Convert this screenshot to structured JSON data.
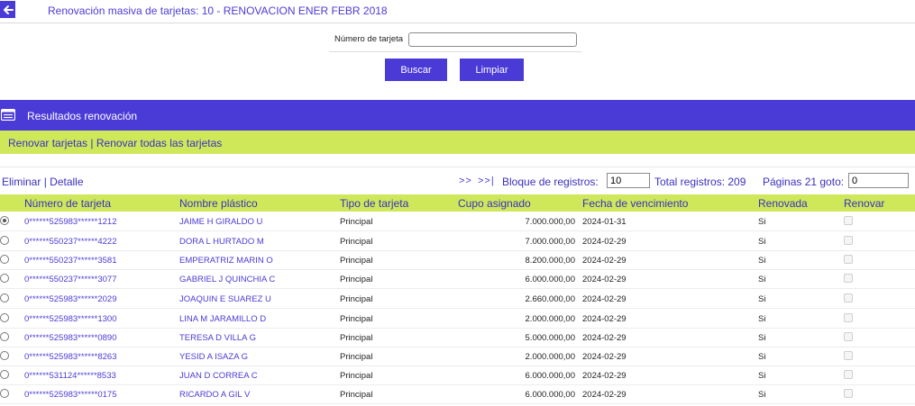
{
  "header": {
    "title": "Renovación masiva de tarjetas: 10 - RENOVACION ENER FEBR 2018",
    "back_icon": "arrow-left-icon"
  },
  "search": {
    "label": "Número de tarjeta",
    "value": "",
    "buscar_label": "Buscar",
    "limpiar_label": "Limpiar"
  },
  "results": {
    "title": "Resultados renovación",
    "icon": "list-icon"
  },
  "actions": {
    "renovar": "Renovar tarjetas",
    "separator": "|",
    "renovar_todas": "Renovar todas las tarjetas"
  },
  "pager": {
    "eliminar": "Eliminar",
    "separator": "|",
    "detalle": "Detalle",
    "next": ">>",
    "last": ">>|",
    "bloque_label": "Bloque de registros:",
    "bloque_value": "10",
    "total_label": "Total registros: 209",
    "paginas_label": "Páginas 21 goto:",
    "goto_value": "0"
  },
  "table": {
    "columns": [
      "Número de tarjeta",
      "Nombre plástico",
      "Tipo de tarjeta",
      "Cupo asignado",
      "Fecha de vencimiento",
      "Renovada",
      "Renovar"
    ],
    "rows": [
      {
        "numero": "0******525983******1212",
        "nombre": "JAIME H GIRALDO U",
        "tipo": "Principal",
        "cupo": "7.000.000,00",
        "fecha": "2024-01-31",
        "renovada": "Si",
        "selected": true
      },
      {
        "numero": "0******550237******4222",
        "nombre": "DORA L HURTADO M",
        "tipo": "Principal",
        "cupo": "7.000.000,00",
        "fecha": "2024-02-29",
        "renovada": "Si",
        "selected": false
      },
      {
        "numero": "0******550237******3581",
        "nombre": "EMPERATRIZ MARIN O",
        "tipo": "Principal",
        "cupo": "8.200.000,00",
        "fecha": "2024-02-29",
        "renovada": "Si",
        "selected": false
      },
      {
        "numero": "0******550237******3077",
        "nombre": "GABRIEL J QUINCHIA C",
        "tipo": "Principal",
        "cupo": "6.000.000,00",
        "fecha": "2024-02-29",
        "renovada": "Si",
        "selected": false
      },
      {
        "numero": "0******525983******2029",
        "nombre": "JOAQUIN E SUAREZ U",
        "tipo": "Principal",
        "cupo": "2.660.000,00",
        "fecha": "2024-02-29",
        "renovada": "Si",
        "selected": false
      },
      {
        "numero": "0******525983******1300",
        "nombre": "LINA M JARAMILLO D",
        "tipo": "Principal",
        "cupo": "2.000.000,00",
        "fecha": "2024-02-29",
        "renovada": "Si",
        "selected": false
      },
      {
        "numero": "0******525983******0890",
        "nombre": "TERESA D VILLA G",
        "tipo": "Principal",
        "cupo": "5.000.000,00",
        "fecha": "2024-02-29",
        "renovada": "Si",
        "selected": false
      },
      {
        "numero": "0******525983******8263",
        "nombre": "YESID A ISAZA G",
        "tipo": "Principal",
        "cupo": "2.000.000,00",
        "fecha": "2024-02-29",
        "renovada": "Si",
        "selected": false
      },
      {
        "numero": "0******531124******8533",
        "nombre": "JUAN D CORREA C",
        "tipo": "Principal",
        "cupo": "6.000.000,00",
        "fecha": "2024-02-29",
        "renovada": "Si",
        "selected": false
      },
      {
        "numero": "0******525983******0175",
        "nombre": "RICARDO A GIL V",
        "tipo": "Principal",
        "cupo": "6.000.000,00",
        "fecha": "2024-02-29",
        "renovada": "Si",
        "selected": false
      }
    ]
  },
  "colors": {
    "primary": "#4b3bd6",
    "accent_green": "#cfe85a",
    "link": "#3a2fc0"
  }
}
